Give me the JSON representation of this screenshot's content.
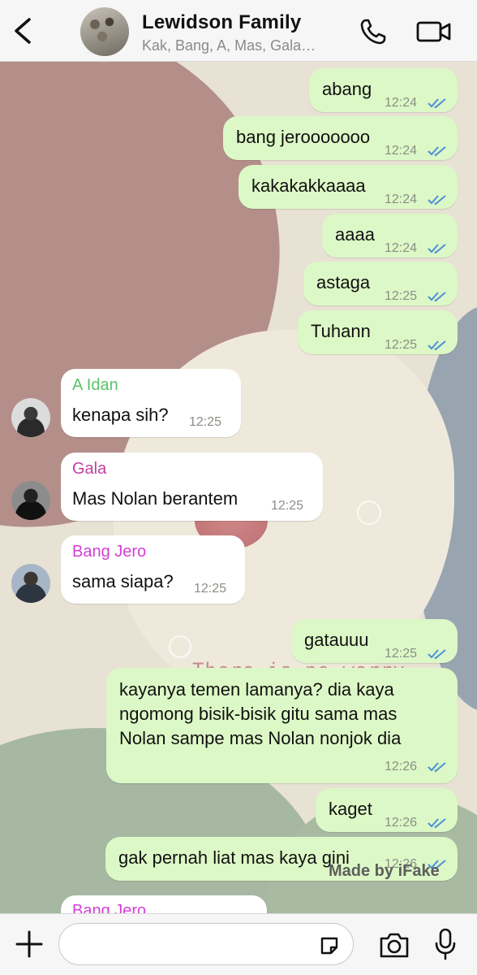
{
  "header": {
    "title": "Lewidson Family",
    "subtitle": "Kak, Bang, A, Mas, Gala…",
    "icons": [
      "chevron-left-icon",
      "group-avatar",
      "phone-icon",
      "video-camera-icon"
    ]
  },
  "background": {
    "text": "There is no worry"
  },
  "messages": [
    {
      "type": "out",
      "text": "abang",
      "time": "12:24"
    },
    {
      "type": "out",
      "text": "bang jerooooooo",
      "time": "12:24"
    },
    {
      "type": "out",
      "text": "kakakakkaaaa",
      "time": "12:24"
    },
    {
      "type": "out",
      "text": "aaaa",
      "time": "12:24"
    },
    {
      "type": "out",
      "text": "astaga",
      "time": "12:25"
    },
    {
      "type": "out",
      "text": "Tuhann",
      "time": "12:25"
    },
    {
      "type": "in",
      "sender": "A Idan",
      "text": "kenapa sih?",
      "time": "12:25"
    },
    {
      "type": "in",
      "sender": "Gala",
      "text": "Mas Nolan berantem",
      "time": "12:25"
    },
    {
      "type": "in",
      "sender": "Bang Jero",
      "text": "sama siapa?",
      "time": "12:25"
    },
    {
      "type": "out",
      "text": "gatauuu",
      "time": "12:25"
    },
    {
      "type": "out",
      "lines": [
        "kayanya temen lamanya? dia kaya",
        "ngomong bisik-bisik gitu sama mas",
        "Nolan sampe mas Nolan nonjok dia"
      ],
      "time": "12:26"
    },
    {
      "type": "out",
      "text": "kaget",
      "time": "12:26"
    },
    {
      "type": "out",
      "text": "gak pernah liat mas kaya gini",
      "time": "12:26"
    },
    {
      "type": "in",
      "sender": "Bang Jero",
      "text": "",
      "time": ""
    }
  ],
  "colors": {
    "outgoing_bubble": "#dcf8c6",
    "incoming_bubble": "#ffffff",
    "ticks": "#4a90d9",
    "sender_idan": "#5ac46a",
    "sender_gala": "#c23fa3",
    "sender_jero": "#d33fd6"
  },
  "watermark": "Made by iFake",
  "input": {
    "placeholder": ""
  }
}
